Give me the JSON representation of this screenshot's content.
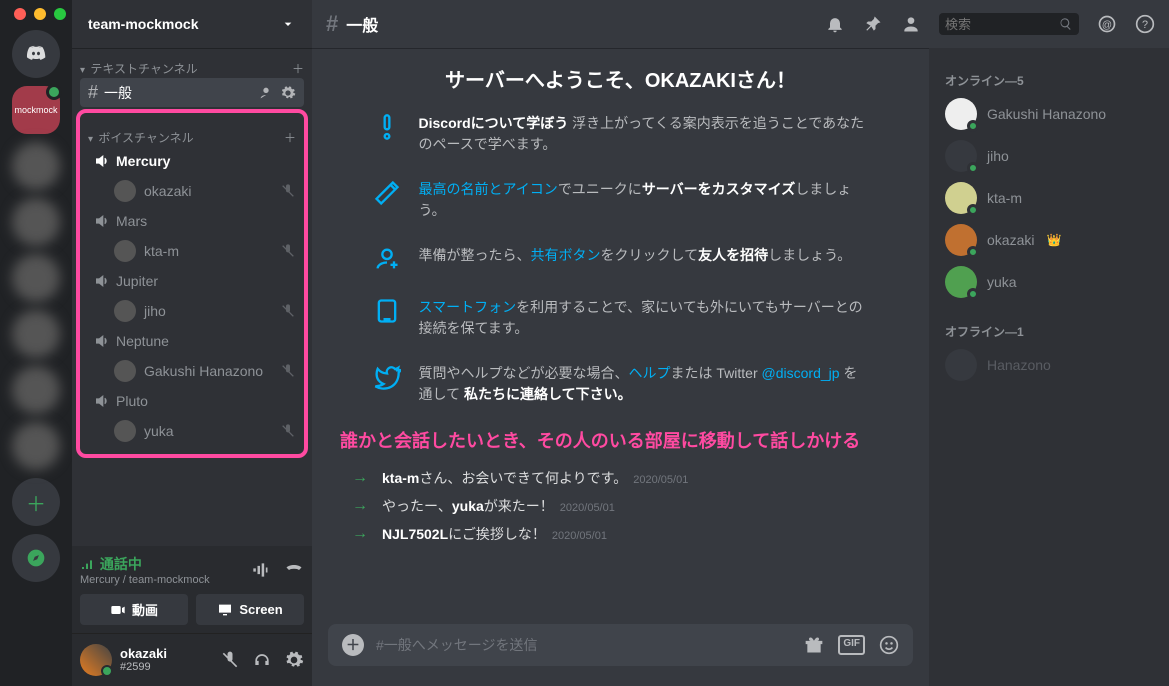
{
  "server_name": "team-mockmock",
  "categories": {
    "text": {
      "label": "テキストチャンネル"
    },
    "voice": {
      "label": "ボイスチャンネル"
    }
  },
  "text_channels": [
    {
      "name": "一般",
      "active": true
    }
  ],
  "voice_channels": [
    {
      "name": "Mercury",
      "users": [
        {
          "name": "okazaki"
        }
      ]
    },
    {
      "name": "Mars",
      "users": [
        {
          "name": "kta-m"
        }
      ]
    },
    {
      "name": "Jupiter",
      "users": [
        {
          "name": "jiho"
        }
      ]
    },
    {
      "name": "Neptune",
      "users": [
        {
          "name": "Gakushi Hanazono"
        }
      ]
    },
    {
      "name": "Pluto",
      "users": [
        {
          "name": "yuka"
        }
      ]
    }
  ],
  "voice_status": {
    "label": "通話中",
    "sub": "Mercury / team-mockmock"
  },
  "buttons": {
    "video": "動画",
    "screen": "Screen"
  },
  "current_user": {
    "name": "okazaki",
    "discriminator": "#2599"
  },
  "header": {
    "channel": "一般",
    "search_placeholder": "検索"
  },
  "welcome": {
    "title": "サーバーへようこそ、OKAZAKIさん！"
  },
  "tips": [
    {
      "icon": "!",
      "html": "<b>Discordについて学ぼう</b> 浮き上がってくる案内表示を追うことであなたのペースで学べます。"
    },
    {
      "icon": "✎",
      "html": "<span class='link'>最高の名前とアイコン</span>でユニークに<b>サーバーをカスタマイズ</b>しましょう。"
    },
    {
      "icon": "👤+",
      "html": "準備が整ったら、<span class='link'>共有ボタン</span>をクリックして<b>友人を招待</b>しましょう。"
    },
    {
      "icon": "📱",
      "html": "<span class='link'>スマートフォン</span>を利用することで、家にいても外にいてもサーバーとの接続を保てます。"
    },
    {
      "icon": "🐦",
      "html": "質問やヘルプなどが必要な場合、<span class='link'>ヘルプ</span>または Twitter <span class='link'>@discord_jp</span> を通して <b>私たちに連絡して下さい。</b>"
    }
  ],
  "annotation": "誰かと会話したいとき、その人のいる部屋に移動して話しかける",
  "messages": [
    {
      "html": "<b>kta-m</b>さん、お会いできて何よりです。",
      "ts": "2020/05/01"
    },
    {
      "html": "やったー、<b>yuka</b>が来たー！",
      "ts": "2020/05/01"
    },
    {
      "html": "<b>NJL7502L</b>にご挨拶しな！",
      "ts": "2020/05/01"
    }
  ],
  "input_placeholder": "#一般へメッセージを送信",
  "members": {
    "online_label": "オンライン—5",
    "online": [
      {
        "name": "Gakushi Hanazono",
        "color": "#eee"
      },
      {
        "name": "jiho",
        "color": "#36393f"
      },
      {
        "name": "kta-m",
        "color": "#d0d090"
      },
      {
        "name": "okazaki",
        "color": "#c07030",
        "owner": true
      },
      {
        "name": "yuka",
        "color": "#50a050"
      }
    ],
    "offline_label": "オフライン—1",
    "offline": [
      {
        "name": "Hanazono"
      }
    ]
  },
  "gif_label": "GIF"
}
